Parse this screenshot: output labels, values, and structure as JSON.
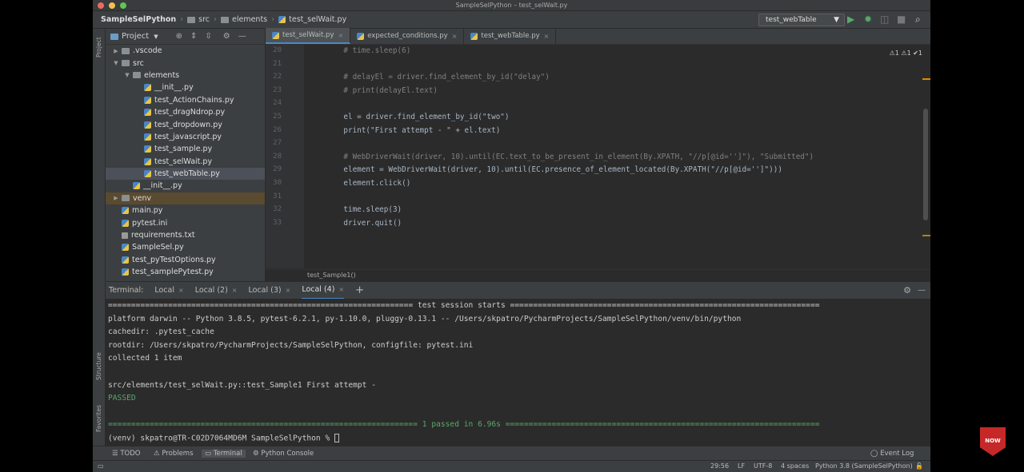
{
  "window": {
    "title": "SampleSelPython – test_selWait.py"
  },
  "breadcrumb": [
    "SampleSelPython",
    "src",
    "elements",
    "test_selWait.py"
  ],
  "toolbar": {
    "run_config": "test_webTable"
  },
  "project": {
    "header": "Project",
    "tree": [
      {
        "label": ".vscode",
        "type": "folder",
        "level": 1,
        "arrow": "▶"
      },
      {
        "label": "src",
        "type": "folder",
        "level": 1,
        "arrow": "▼"
      },
      {
        "label": "elements",
        "type": "folder",
        "level": 2,
        "arrow": "▼"
      },
      {
        "label": "__init__.py",
        "type": "py",
        "level": 3,
        "arrow": ""
      },
      {
        "label": "test_ActionChains.py",
        "type": "py",
        "level": 3,
        "arrow": ""
      },
      {
        "label": "test_dragNdrop.py",
        "type": "py",
        "level": 3,
        "arrow": ""
      },
      {
        "label": "test_dropdown.py",
        "type": "py",
        "level": 3,
        "arrow": ""
      },
      {
        "label": "test_javascript.py",
        "type": "py",
        "level": 3,
        "arrow": ""
      },
      {
        "label": "test_sample.py",
        "type": "py",
        "level": 3,
        "arrow": ""
      },
      {
        "label": "test_selWait.py",
        "type": "py",
        "level": 3,
        "arrow": ""
      },
      {
        "label": "test_webTable.py",
        "type": "py",
        "level": 3,
        "arrow": "",
        "selected": true
      },
      {
        "label": "__init__.py",
        "type": "py",
        "level": 2,
        "arrow": ""
      },
      {
        "label": "venv",
        "type": "folder",
        "level": 1,
        "arrow": "▶",
        "highlight": true
      },
      {
        "label": "main.py",
        "type": "py",
        "level": 1,
        "arrow": ""
      },
      {
        "label": "pytest.ini",
        "type": "py",
        "level": 1,
        "arrow": ""
      },
      {
        "label": "requirements.txt",
        "type": "txt",
        "level": 1,
        "arrow": ""
      },
      {
        "label": "SampleSel.py",
        "type": "py",
        "level": 1,
        "arrow": ""
      },
      {
        "label": "test_pyTestOptions.py",
        "type": "py",
        "level": 1,
        "arrow": ""
      },
      {
        "label": "test_samplePytest.py",
        "type": "py",
        "level": 1,
        "arrow": ""
      }
    ]
  },
  "editor": {
    "tabs": [
      "test_selWait.py",
      "expected_conditions.py",
      "test_webTable.py"
    ],
    "inspections": "⚠1 ⚠1 ✔1",
    "lines": [
      {
        "n": "20",
        "t": "    # time.sleep(6)"
      },
      {
        "n": "21",
        "t": ""
      },
      {
        "n": "22",
        "t": "    # delayEl = driver.find_element_by_id(\"delay\")"
      },
      {
        "n": "23",
        "t": "    # print(delayEl.text)"
      },
      {
        "n": "24",
        "t": ""
      },
      {
        "n": "25",
        "t": "    el = driver.find_element_by_id(\"two\")"
      },
      {
        "n": "26",
        "t": "    print(\"First attempt - \" + el.text)"
      },
      {
        "n": "27",
        "t": ""
      },
      {
        "n": "28",
        "t": "    # WebDriverWait(driver, 10).until(EC.text_to_be_present_in_element(By.XPATH, \"//p[@id='']\"), \"Submitted\")"
      },
      {
        "n": "29",
        "t": "    element = WebDriverWait(driver, 10).until(EC.presence_of_element_located(By.XPATH(\"//p[@id='']\")))"
      },
      {
        "n": "30",
        "t": "    element.click()"
      },
      {
        "n": "31",
        "t": ""
      },
      {
        "n": "32",
        "t": "    time.sleep(3)"
      },
      {
        "n": "33",
        "t": "    driver.quit()"
      }
    ],
    "crumb": "test_Sample1()"
  },
  "terminal": {
    "label": "Terminal:",
    "tabs": [
      "Local",
      "Local (2)",
      "Local (3)",
      "Local (4)"
    ],
    "lines": [
      "================================================================== test session starts ===================================================================",
      "platform darwin -- Python 3.8.5, pytest-6.2.1, py-1.10.0, pluggy-0.13.1 -- /Users/skpatro/PycharmProjects/SampleSelPython/venv/bin/python",
      "cachedir: .pytest_cache",
      "rootdir: /Users/skpatro/PycharmProjects/SampleSelPython, configfile: pytest.ini",
      "collected 1 item",
      "",
      "src/elements/test_selWait.py::test_Sample1 First attempt -",
      "PASSED",
      "",
      "=================================================================== 1 passed in 6.96s ====================================================================",
      "(venv) skpatro@TR-C02D7064MD6M SampleSelPython % "
    ]
  },
  "toolwindows": [
    "TODO",
    "Problems",
    "Terminal",
    "Python Console",
    "Event Log"
  ],
  "sidebar_labels": {
    "project": "Project",
    "structure": "Structure",
    "favorites": "Favorites"
  },
  "statusbar": {
    "pos": "29:56",
    "lf": "LF",
    "enc": "UTF-8",
    "indent": "4 spaces",
    "interp": "Python 3.8 (SampleSelPython)"
  },
  "watermark": "NOW"
}
